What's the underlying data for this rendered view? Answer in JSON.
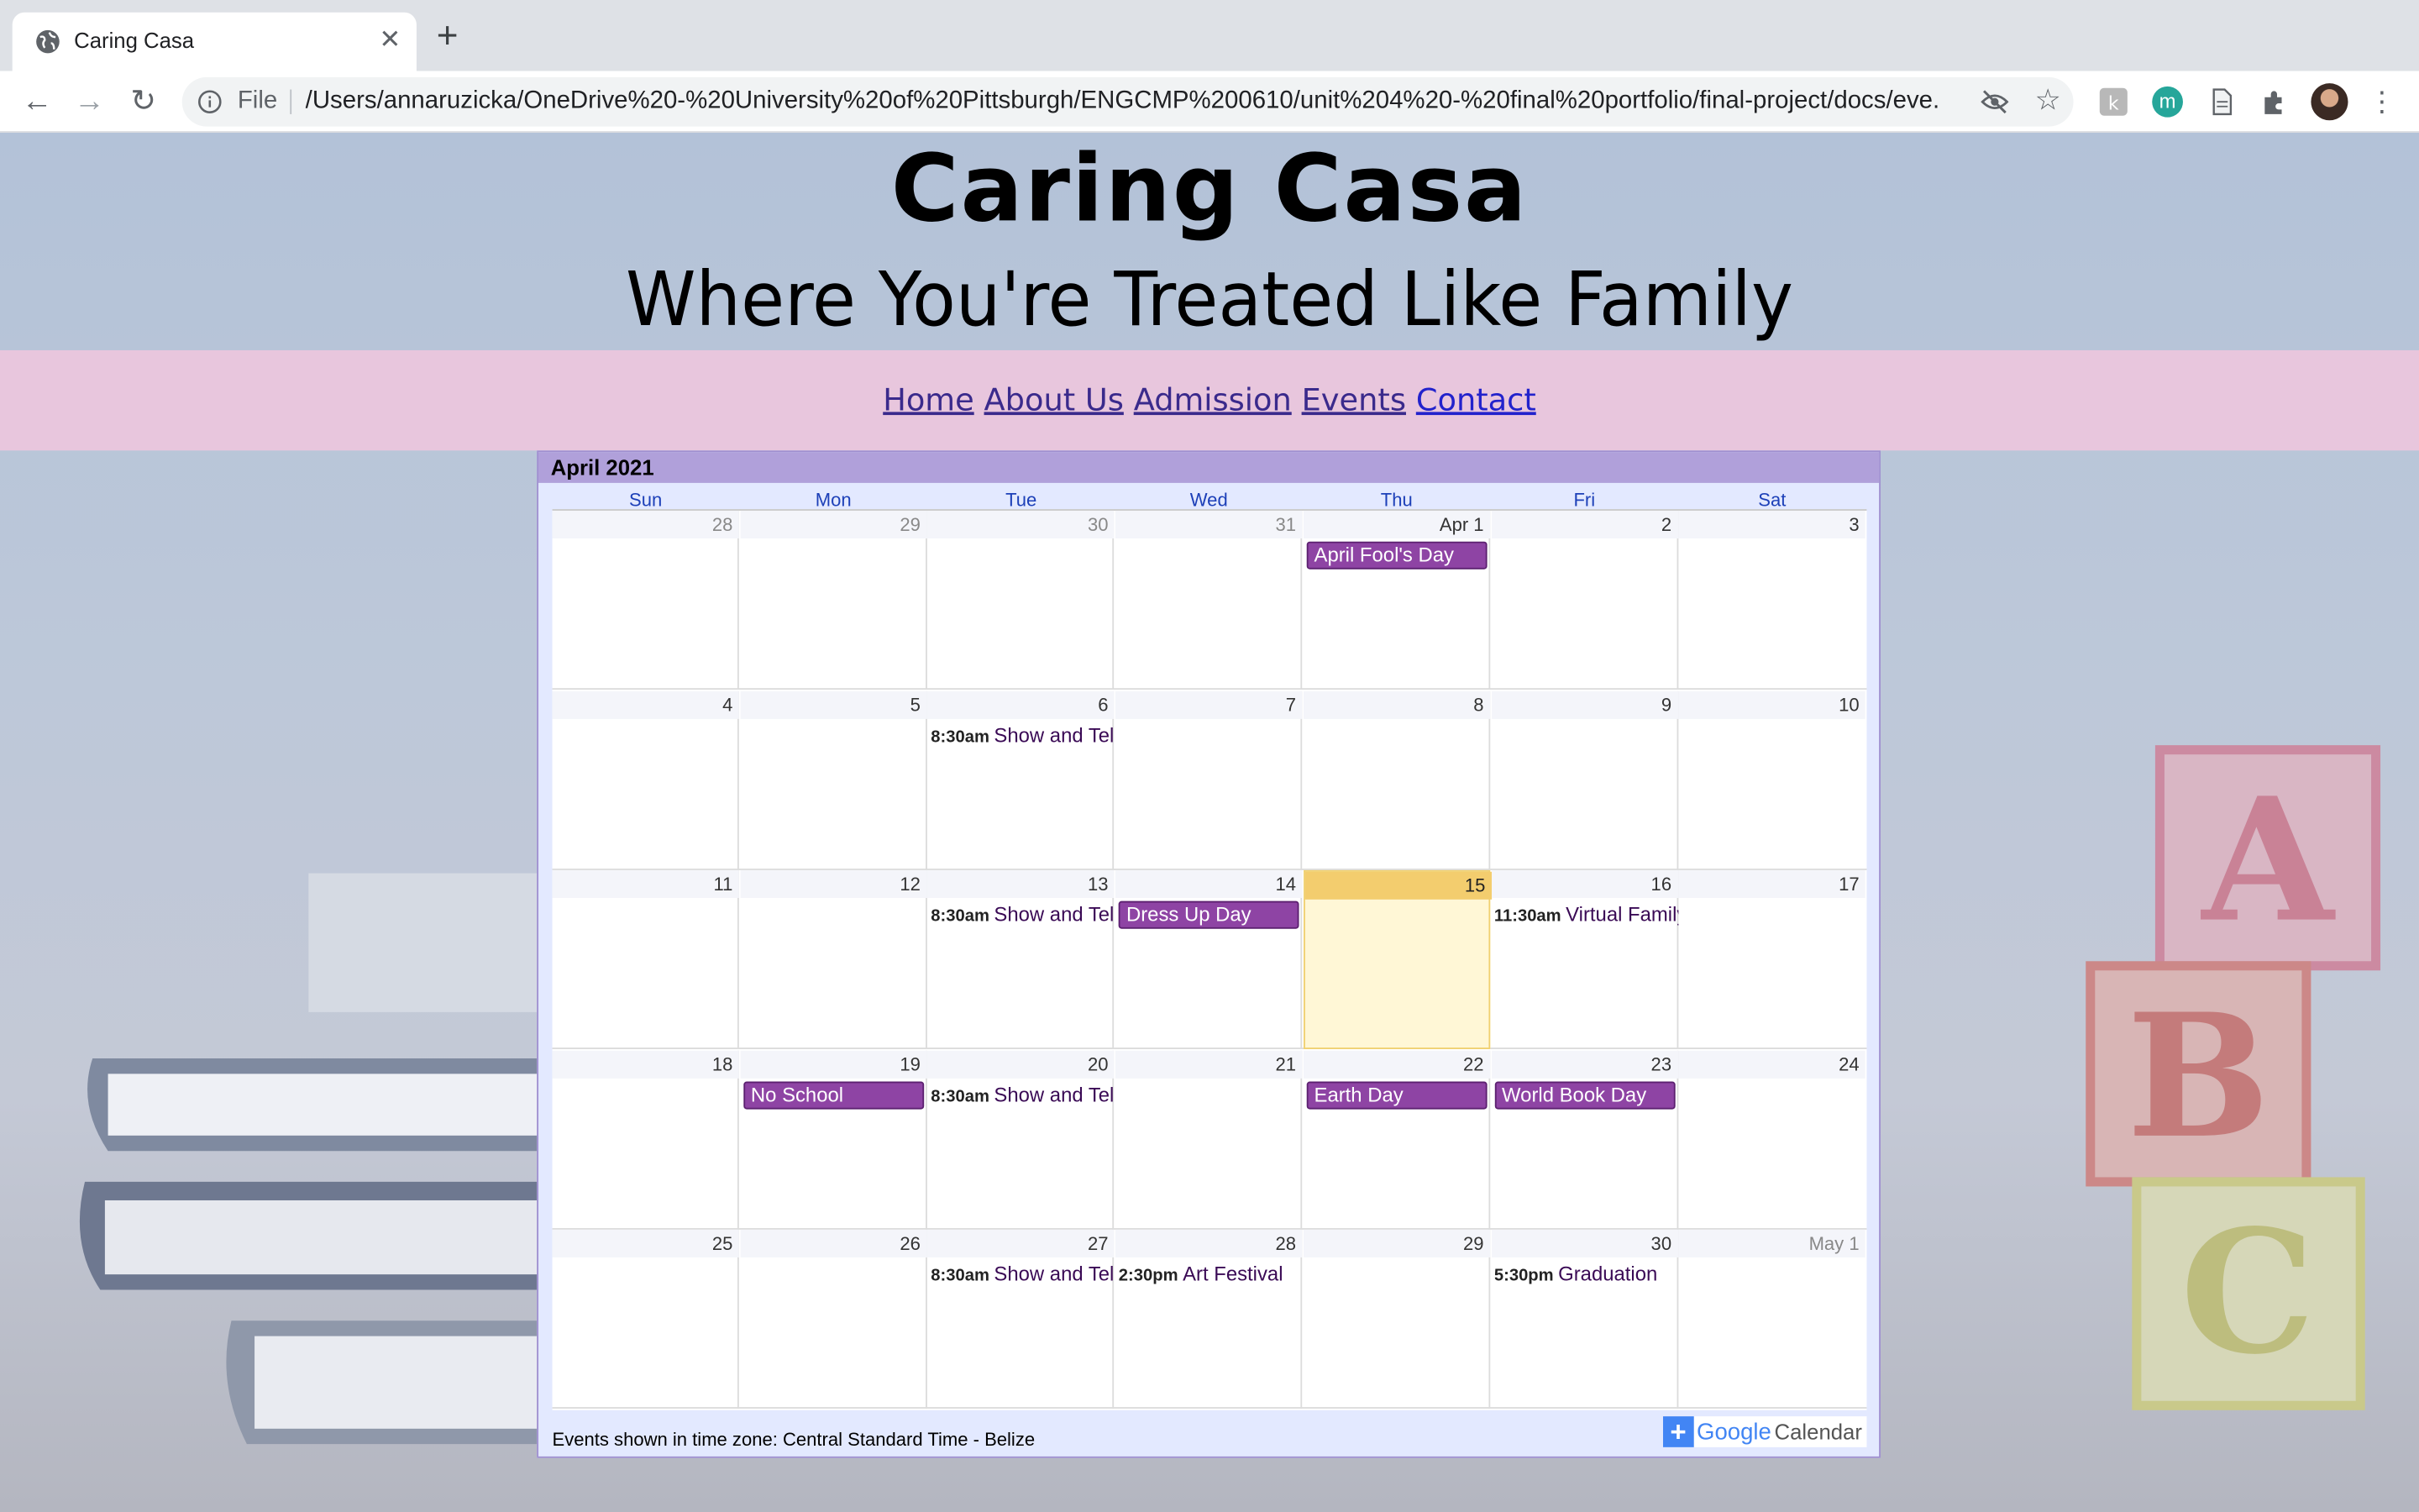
{
  "browser": {
    "tab_title": "Caring Casa",
    "new_tab_label": "+",
    "close_label": "✕",
    "file_label": "File",
    "url": "/Users/annaruzicka/OneDrive%20-%20University%20of%20Pittsburgh/ENGCMP%200610/unit%204%20-%20final%20portfolio/final-project/docs/eve...",
    "extension_m_label": "m"
  },
  "site": {
    "title": "Caring Casa",
    "tagline": "Where You're Treated Like Family"
  },
  "nav": {
    "home": "Home",
    "about": "About Us",
    "admission": "Admission",
    "events": "Events",
    "contact": "Contact"
  },
  "calendar": {
    "month": "April 2021",
    "days_of_week": [
      "Sun",
      "Mon",
      "Tue",
      "Wed",
      "Thu",
      "Fri",
      "Sat"
    ],
    "weeks": [
      [
        {
          "num": "28",
          "other": true
        },
        {
          "num": "29",
          "other": true
        },
        {
          "num": "30",
          "other": true
        },
        {
          "num": "31",
          "other": true
        },
        {
          "num": "Apr 1",
          "event": {
            "type": "bar",
            "title": "April Fool's Day"
          }
        },
        {
          "num": "2"
        },
        {
          "num": "3"
        }
      ],
      [
        {
          "num": "4"
        },
        {
          "num": "5"
        },
        {
          "num": "6",
          "event": {
            "type": "timed",
            "time": "8:30am",
            "title": "Show and Tell"
          }
        },
        {
          "num": "7"
        },
        {
          "num": "8"
        },
        {
          "num": "9"
        },
        {
          "num": "10"
        }
      ],
      [
        {
          "num": "11"
        },
        {
          "num": "12"
        },
        {
          "num": "13",
          "event": {
            "type": "timed",
            "time": "8:30am",
            "title": "Show and Tell"
          }
        },
        {
          "num": "14",
          "event": {
            "type": "bar",
            "title": "Dress Up Day"
          }
        },
        {
          "num": "15",
          "today": true
        },
        {
          "num": "16",
          "event": {
            "type": "timed",
            "time": "11:30am",
            "title": "Virtual Family"
          }
        },
        {
          "num": "17"
        }
      ],
      [
        {
          "num": "18"
        },
        {
          "num": "19",
          "event": {
            "type": "bar",
            "title": "No School"
          }
        },
        {
          "num": "20",
          "event": {
            "type": "timed",
            "time": "8:30am",
            "title": "Show and Tell"
          }
        },
        {
          "num": "21"
        },
        {
          "num": "22",
          "event": {
            "type": "bar",
            "title": "Earth Day"
          }
        },
        {
          "num": "23",
          "event": {
            "type": "bar",
            "title": "World Book Day"
          }
        },
        {
          "num": "24"
        }
      ],
      [
        {
          "num": "25"
        },
        {
          "num": "26"
        },
        {
          "num": "27",
          "event": {
            "type": "timed",
            "time": "8:30am",
            "title": "Show and Tell"
          }
        },
        {
          "num": "28",
          "event": {
            "type": "timed",
            "time": "2:30pm",
            "title": "Art Festival"
          }
        },
        {
          "num": "29"
        },
        {
          "num": "30",
          "event": {
            "type": "timed",
            "time": "5:30pm",
            "title": "Graduation"
          }
        },
        {
          "num": "May 1",
          "other": true
        }
      ]
    ],
    "timezone_note": "Events shown in time zone: Central Standard Time - Belize",
    "badge_plus": "+",
    "badge_google": "Google",
    "badge_calendar": "Calendar"
  },
  "colors": {
    "nav_band": "#e8c6dd",
    "calendar_header": "#b0a0da",
    "event_bar": "#8e44a4",
    "today": "#fff7d6"
  }
}
